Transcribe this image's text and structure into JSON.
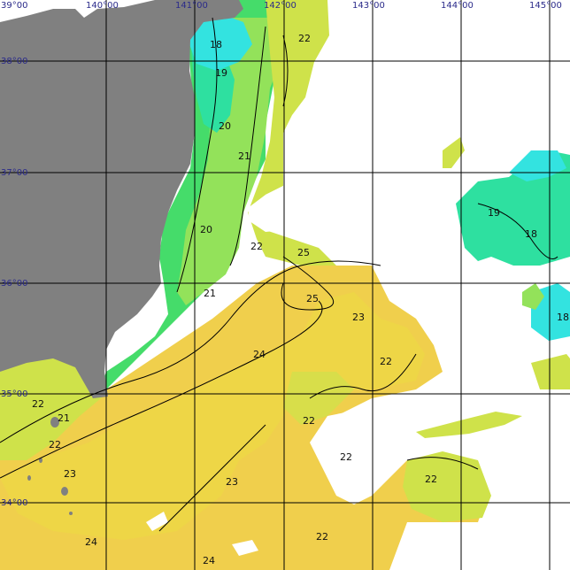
{
  "longitude_labels": [
    "139°00",
    "140°00",
    "141°00",
    "142°00",
    "143°00",
    "144°00",
    "145°00"
  ],
  "latitude_labels": [
    "38°00",
    "37°00",
    "36°00",
    "35°00",
    "34°00"
  ],
  "latitude_top_label": "39°00",
  "contour_labels": [
    "18",
    "19",
    "20",
    "21",
    "20",
    "21",
    "22",
    "22",
    "25",
    "25",
    "23",
    "24",
    "22",
    "22",
    "22",
    "22",
    "21",
    "22",
    "23",
    "23",
    "24",
    "24",
    "22",
    "19",
    "18",
    "18",
    "22"
  ],
  "colors": {
    "land": "#808080",
    "ocean_no_data": "#ffffff",
    "sst_18": "#33e3e0",
    "sst_19": "#2ee0a0",
    "sst_20": "#45dc6a",
    "sst_21": "#93e25a",
    "sst_22": "#cfe24a",
    "sst_23": "#eed646",
    "sst_24": "#f1cd4d",
    "sst_25": "#f4c756",
    "grid": "#000000",
    "tick_text": "#2a2a8a"
  }
}
